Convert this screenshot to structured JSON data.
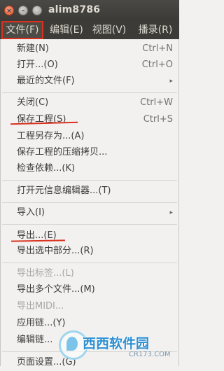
{
  "window": {
    "title": "alim8786"
  },
  "menubar": {
    "file": "文件(F)",
    "edit": "编辑(E)",
    "view": "视图(V)",
    "transport": "播录(R)"
  },
  "file_menu": {
    "items": [
      {
        "label": "新建(N)",
        "shortcut": "Ctrl+N"
      },
      {
        "label": "打开...(O)",
        "shortcut": "Ctrl+O"
      },
      {
        "label": "最近的文件(F)",
        "submenu": true
      },
      {
        "label": "关闭(C)",
        "shortcut": "Ctrl+W"
      },
      {
        "label": "保存工程(S)",
        "shortcut": "Ctrl+S",
        "highlighted": true
      },
      {
        "label": "工程另存为...(A)"
      },
      {
        "label": "保存工程的压缩拷贝..."
      },
      {
        "label": "检查依赖...(K)"
      },
      {
        "label": "打开元信息编辑器...(T)"
      },
      {
        "label": "导入(I)",
        "submenu": true
      },
      {
        "label": "导出...(E)",
        "highlighted": true
      },
      {
        "label": "导出选中部分...(R)"
      },
      {
        "label": "导出标签...(L)",
        "disabled": true
      },
      {
        "label": "导出多个文件...(M)"
      },
      {
        "label": "导出MIDI...",
        "disabled": true
      },
      {
        "label": "应用链...(Y)"
      },
      {
        "label": "编辑链..."
      },
      {
        "label": "页面设置...(G)"
      }
    ],
    "arrow_glyph": "▸"
  },
  "watermark": {
    "text": "西西软件园",
    "sub": "CR173.COM"
  },
  "colors": {
    "titlebar": "#3c3b37",
    "menubar": "#3c3b37",
    "menu_bg": "#f2f1f0",
    "annotation_red": "#d8321f",
    "watermark_blue": "#2e8fd0"
  },
  "icons": [
    "close-icon",
    "minimize-icon",
    "maximize-icon",
    "submenu-arrow-icon",
    "watermark-logo-icon"
  ]
}
